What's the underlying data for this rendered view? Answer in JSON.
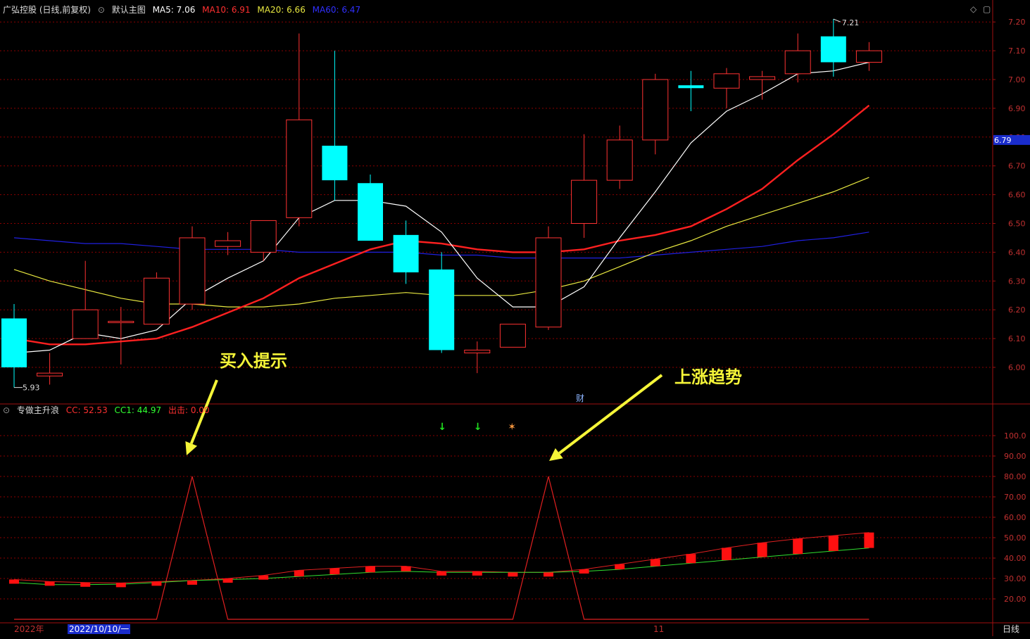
{
  "header": {
    "stock_name": "广弘控股 (日线,前复权)",
    "main_chart_label": "默认主图",
    "ma5_label": "MA5: 7.06",
    "ma10_label": "MA10: 6.91",
    "ma20_label": "MA20: 6.66",
    "ma60_label": "MA60: 6.47"
  },
  "indicator_header": {
    "name": "专做主升浪",
    "cc_label": "CC: 52.53",
    "cc1_label": "CC1: 44.97",
    "exit_label": "出击: 0.00"
  },
  "annotations": {
    "buy_hint": "买入提示",
    "uptrend": "上涨趋势",
    "finance_marker": "财"
  },
  "price_axis": {
    "labels": [
      "7.20",
      "7.10",
      "7.00",
      "6.90",
      "6.80",
      "6.70",
      "6.60",
      "6.50",
      "6.40",
      "6.30",
      "6.20",
      "6.10",
      "6.00"
    ],
    "current_price": "6.79",
    "high_label": "7.21",
    "low_label": "5.93"
  },
  "indicator_axis": {
    "labels": [
      "100.0",
      "90.00",
      "80.00",
      "70.00",
      "60.00",
      "50.00",
      "40.00",
      "30.00",
      "20.00"
    ]
  },
  "bottom_axis": {
    "year_label": "2022年",
    "cursor_date": "2022/10/10/一",
    "month_label": "11",
    "period_label": "日线"
  },
  "colors": {
    "up": "#ff3232",
    "down": "#00ffff",
    "ma5": "#ffffff",
    "ma10": "#ff2020",
    "ma20": "#e8e840",
    "ma60": "#2020e0",
    "grid": "#8b0000",
    "annotation": "#f5f538"
  },
  "chart_data": [
    {
      "type": "candlestick",
      "title": "广弘控股 (日线,前复权)",
      "ylim": [
        5.93,
        7.21
      ],
      "candles": [
        {
          "open": 6.17,
          "high": 6.22,
          "low": 5.93,
          "close": 6.0
        },
        {
          "open": 5.97,
          "high": 6.05,
          "low": 5.94,
          "close": 5.98
        },
        {
          "open": 6.1,
          "high": 6.37,
          "low": 6.1,
          "close": 6.2
        },
        {
          "open": 6.16,
          "high": 6.21,
          "low": 6.01,
          "close": 6.16
        },
        {
          "open": 6.15,
          "high": 6.33,
          "low": 6.15,
          "close": 6.31
        },
        {
          "open": 6.22,
          "high": 6.49,
          "low": 6.2,
          "close": 6.45
        },
        {
          "open": 6.42,
          "high": 6.47,
          "low": 6.39,
          "close": 6.44
        },
        {
          "open": 6.4,
          "high": 6.51,
          "low": 6.37,
          "close": 6.51
        },
        {
          "open": 6.52,
          "high": 7.16,
          "low": 6.49,
          "close": 6.86
        },
        {
          "open": 6.77,
          "high": 7.1,
          "low": 6.58,
          "close": 6.65
        },
        {
          "open": 6.64,
          "high": 6.67,
          "low": 6.44,
          "close": 6.44
        },
        {
          "open": 6.46,
          "high": 6.51,
          "low": 6.29,
          "close": 6.33
        },
        {
          "open": 6.34,
          "high": 6.4,
          "low": 6.05,
          "close": 6.06
        },
        {
          "open": 6.05,
          "high": 6.09,
          "low": 5.98,
          "close": 6.06
        },
        {
          "open": 6.07,
          "high": 6.15,
          "low": 6.07,
          "close": 6.15
        },
        {
          "open": 6.14,
          "high": 6.49,
          "low": 6.13,
          "close": 6.45
        },
        {
          "open": 6.5,
          "high": 6.81,
          "low": 6.45,
          "close": 6.65
        },
        {
          "open": 6.65,
          "high": 6.84,
          "low": 6.62,
          "close": 6.79
        },
        {
          "open": 6.79,
          "high": 7.02,
          "low": 6.74,
          "close": 7.0
        },
        {
          "open": 6.98,
          "high": 7.03,
          "low": 6.89,
          "close": 6.97
        },
        {
          "open": 6.97,
          "high": 7.04,
          "low": 6.9,
          "close": 7.02
        },
        {
          "open": 7.0,
          "high": 7.03,
          "low": 6.93,
          "close": 7.01
        },
        {
          "open": 7.02,
          "high": 7.16,
          "low": 6.99,
          "close": 7.1
        },
        {
          "open": 7.15,
          "high": 7.21,
          "low": 7.01,
          "close": 7.06
        },
        {
          "open": 7.06,
          "high": 7.13,
          "low": 7.03,
          "close": 7.1
        }
      ],
      "series": [
        {
          "name": "MA5",
          "values": [
            6.05,
            6.06,
            6.12,
            6.1,
            6.13,
            6.24,
            6.31,
            6.37,
            6.52,
            6.58,
            6.58,
            6.56,
            6.47,
            6.31,
            6.21,
            6.21,
            6.28,
            6.45,
            6.61,
            6.78,
            6.89,
            6.95,
            7.02,
            7.03,
            7.06
          ]
        },
        {
          "name": "MA10",
          "values": [
            6.1,
            6.08,
            6.08,
            6.09,
            6.1,
            6.14,
            6.19,
            6.24,
            6.31,
            6.36,
            6.41,
            6.44,
            6.43,
            6.41,
            6.4,
            6.4,
            6.41,
            6.44,
            6.46,
            6.49,
            6.55,
            6.62,
            6.72,
            6.81,
            6.91
          ]
        },
        {
          "name": "MA20",
          "values": [
            6.34,
            6.3,
            6.27,
            6.24,
            6.22,
            6.22,
            6.21,
            6.21,
            6.22,
            6.24,
            6.25,
            6.26,
            6.25,
            6.25,
            6.25,
            6.27,
            6.3,
            6.35,
            6.4,
            6.44,
            6.49,
            6.53,
            6.57,
            6.61,
            6.66
          ]
        },
        {
          "name": "MA60",
          "values": [
            6.45,
            6.44,
            6.43,
            6.43,
            6.42,
            6.41,
            6.41,
            6.41,
            6.4,
            6.4,
            6.4,
            6.4,
            6.39,
            6.39,
            6.38,
            6.38,
            6.38,
            6.38,
            6.39,
            6.4,
            6.41,
            6.42,
            6.44,
            6.45,
            6.47
          ]
        }
      ]
    },
    {
      "type": "line",
      "title": "专做主升浪",
      "ylim": [
        10,
        100
      ],
      "series": [
        {
          "name": "CC",
          "values": [
            29.5,
            28.5,
            28.0,
            27.8,
            28.5,
            29.0,
            30.0,
            31.5,
            34.0,
            35.0,
            36.0,
            36.0,
            33.5,
            33.5,
            33.0,
            33.0,
            34.5,
            37.0,
            39.5,
            42.0,
            45.0,
            47.5,
            49.5,
            51.0,
            52.53
          ]
        },
        {
          "name": "CC1",
          "values": [
            28.0,
            27.0,
            27.0,
            27.2,
            28.0,
            29.0,
            29.5,
            30.0,
            31.0,
            32.0,
            33.0,
            33.5,
            33.0,
            33.0,
            33.0,
            33.0,
            33.5,
            34.5,
            36.0,
            37.5,
            39.0,
            40.5,
            42.0,
            43.5,
            44.97
          ]
        },
        {
          "name": "出击",
          "values": [
            0,
            0,
            0,
            0,
            0,
            80,
            0,
            0,
            0,
            0,
            0,
            0,
            0,
            0,
            0,
            80,
            0,
            0,
            0,
            0,
            0,
            0,
            0,
            0,
            0
          ]
        }
      ],
      "signals": [
        {
          "index": 12,
          "type": "down-arrow"
        },
        {
          "index": 13,
          "type": "down-arrow"
        },
        {
          "index": 14,
          "type": "runner"
        }
      ]
    }
  ]
}
